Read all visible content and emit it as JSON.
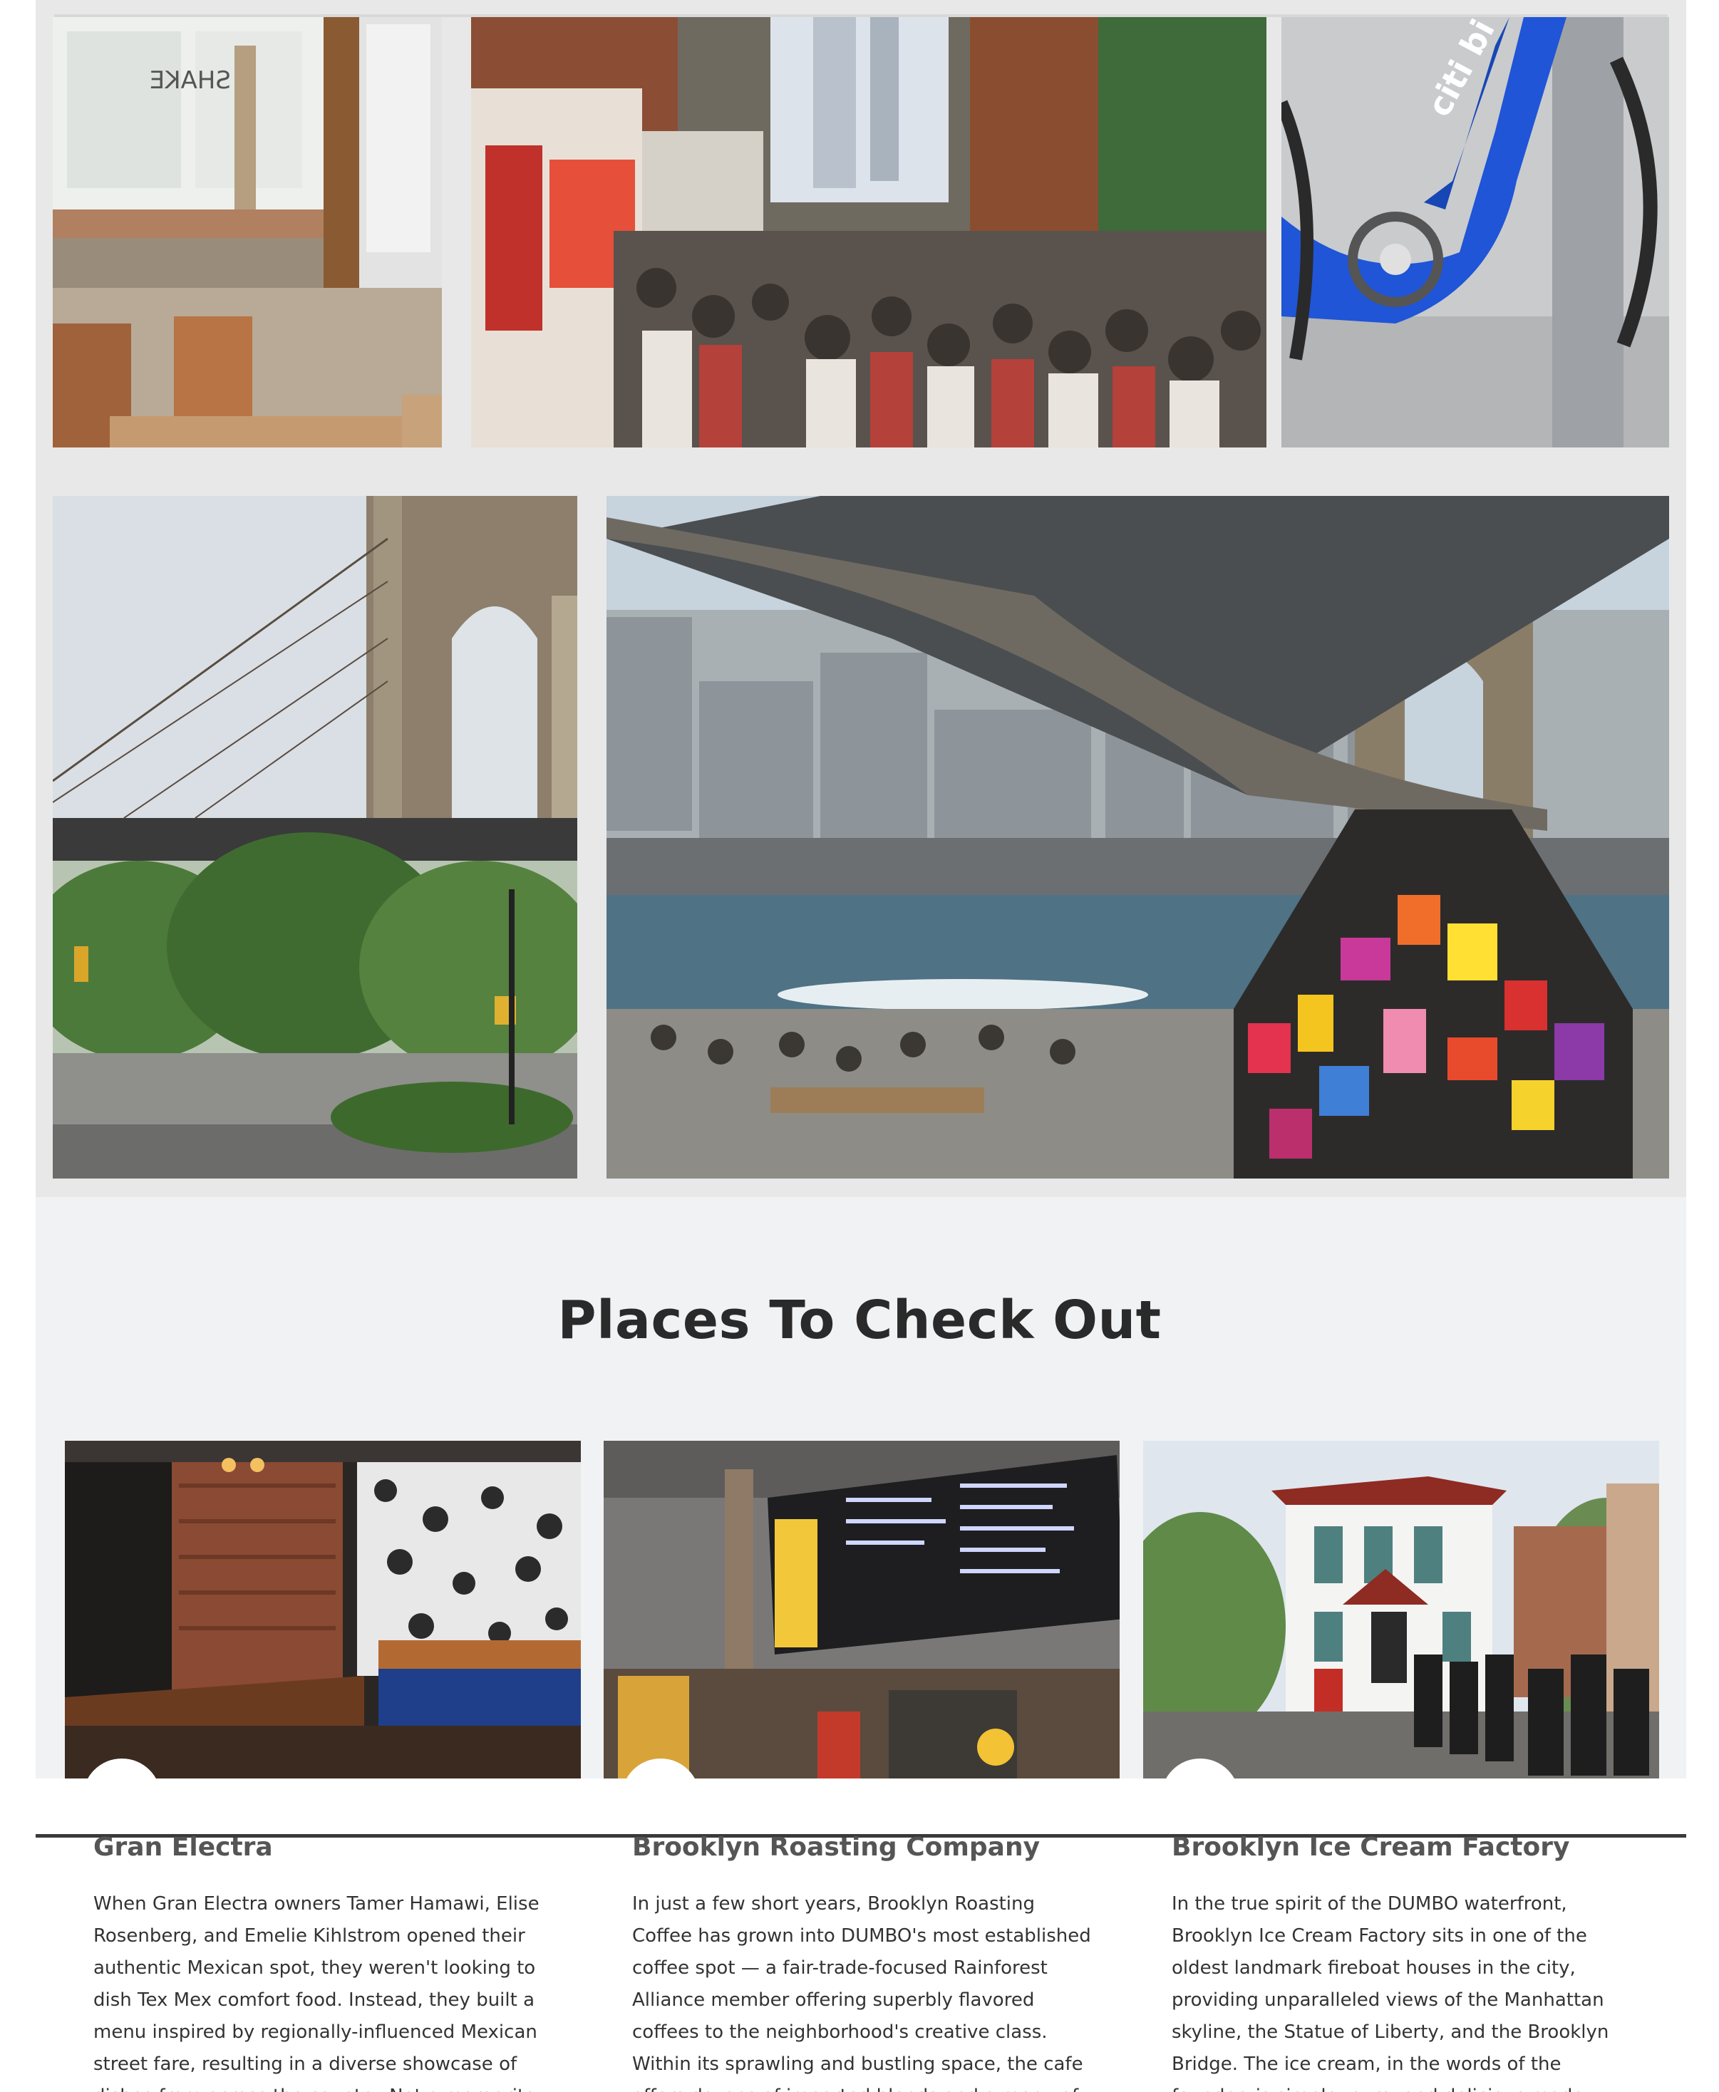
{
  "gallery": {
    "photos": [
      {
        "icon": "restaurant-interior-photo"
      },
      {
        "icon": "food-trucks-crowd-photo"
      },
      {
        "icon": "citi-bike-photo"
      },
      {
        "icon": "brooklyn-bridge-tower-photo"
      },
      {
        "icon": "dumbo-street-trees-photo"
      },
      {
        "icon": "waterfront-glass-house-photo"
      }
    ],
    "bike_brand_text": "citi bi",
    "shop_window_text": "SHAKE"
  },
  "section": {
    "title": "Places To Check Out"
  },
  "places": [
    {
      "name": "Gran Electra",
      "description": "When Gran Electra owners Tamer Hamawi, Elise Rosenberg, and Emelie Kihlstrom opened their authentic Mexican spot, they weren't looking to dish Tex Mex comfort food. Instead, they built a menu inspired by regionally-influenced Mexican street fare, resulting in a diverse showcase of dishes from across the country. Not a margarita lover? All"
    },
    {
      "name": "Brooklyn Roasting Company",
      "description": "In just a few short years, Brooklyn Roasting Coffee has grown into DUMBO's most established coffee spot — a fair-trade-focused Rainforest Alliance member offering superbly flavored coffees to the neighborhood's creative class. Within its sprawling and bustling space, the cafe offers dozens of imported blends and a menu of espresso options"
    },
    {
      "name": "Brooklyn Ice Cream Factory",
      "description": "In the true spirit of the DUMBO waterfront, Brooklyn Ice Cream Factory sits in one of the oldest landmark fireboat houses in the city, providing unparalleled views of the Manhattan skyline, the Statue of Liberty, and the Brooklyn Bridge. The ice cream, in the words of the founder, is simple, pure, and delicious made fresh right in house. And at sunset the"
    }
  ],
  "colors": {
    "panel_bg": "#f1f2f4",
    "title_text": "#2a2a2a",
    "card_title_text": "#555555",
    "divider": "#3a3a3a",
    "citi_bike_blue": "#1f55d6"
  }
}
